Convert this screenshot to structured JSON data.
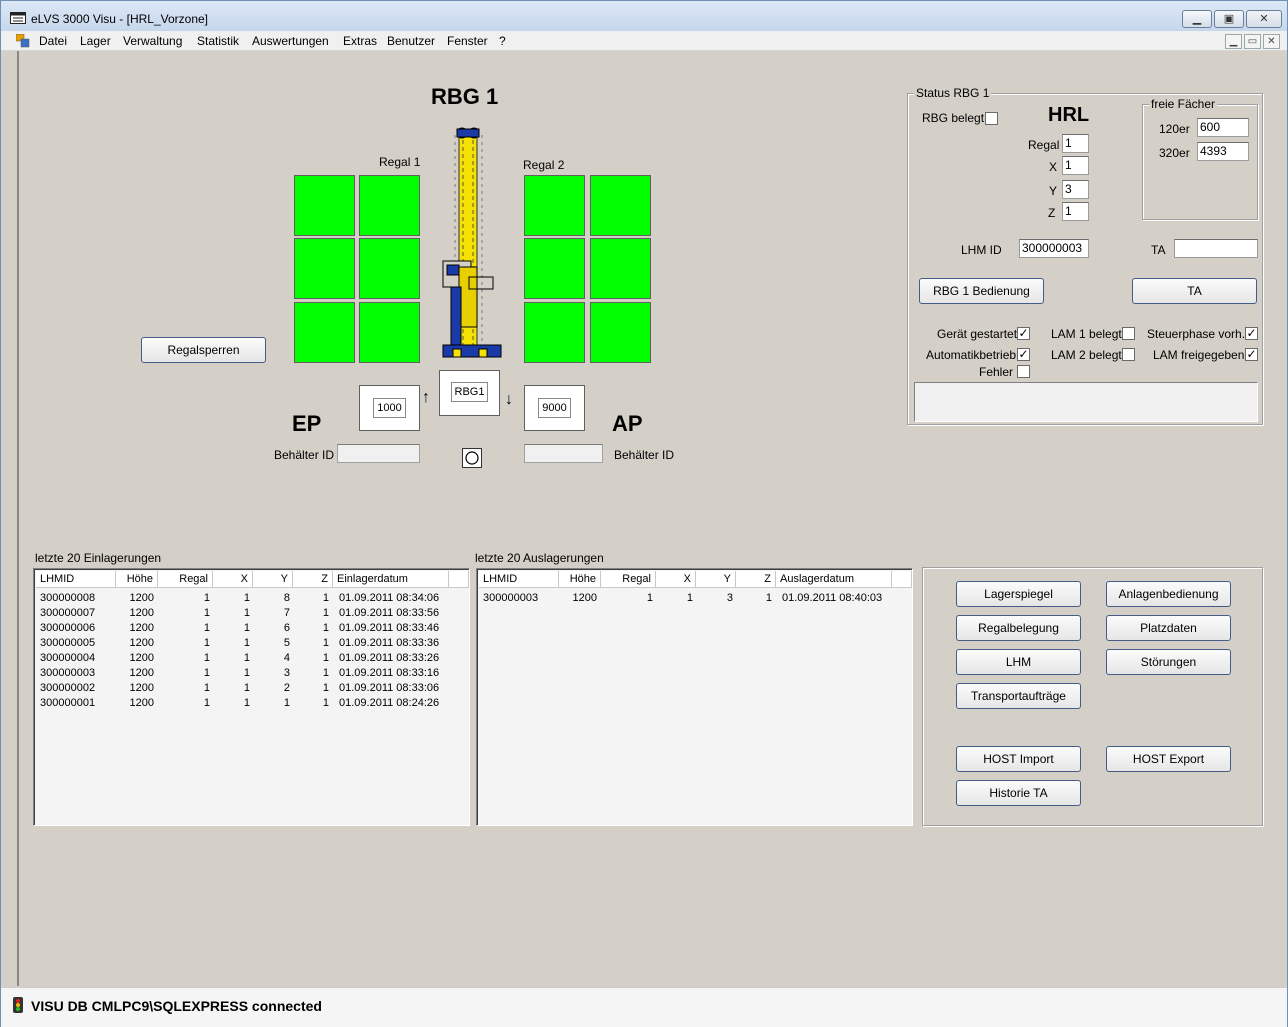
{
  "window": {
    "title": "eLVS 3000 Visu - [HRL_Vorzone]"
  },
  "menu": [
    "Datei",
    "Lager",
    "Verwaltung",
    "Statistik",
    "Auswertungen",
    "Extras",
    "Benutzer",
    "Fenster",
    "?"
  ],
  "visu": {
    "rbg_title": "RBG 1",
    "regal1_label": "Regal 1",
    "regal2_label": "Regal 2",
    "ep_label": "EP",
    "ap_label": "AP",
    "ep_value": "1000",
    "rbg_box": "RBG1",
    "ap_value": "9000",
    "behaelter_id_label_left": "Behälter ID",
    "behaelter_id_label_right": "Behälter ID",
    "behaelter_id_left_value": "",
    "behaelter_id_right_value": "",
    "regalsperren_button": "Regalsperren",
    "arrow_up": "↑",
    "arrow_down": "↓",
    "cell_color": "#00ff00"
  },
  "status": {
    "group_title": "Status RBG 1",
    "rbg_belegt_label": "RBG belegt",
    "rbg_belegt_checked": false,
    "hrl_title": "HRL",
    "regal_label": "Regal",
    "regal_value": "1",
    "x_label": "X",
    "x_value": "1",
    "y_label": "Y",
    "y_value": "3",
    "z_label": "Z",
    "z_value": "1",
    "freie_faecher_title": "freie Fächer",
    "f120_label": "120er",
    "f120_value": "600",
    "f320_label": "320er",
    "f320_value": "4393",
    "lhm_id_label": "LHM ID",
    "lhm_id_value": "300000003",
    "ta_label": "TA",
    "ta_value": "",
    "rbg_bedienung_button": "RBG 1 Bedienung",
    "ta_button": "TA",
    "geraet_gestartet_label": "Gerät gestartet",
    "geraet_gestartet": true,
    "automatikbetrieb_label": "Automatikbetrieb",
    "automatikbetrieb": true,
    "fehler_label": "Fehler",
    "fehler": false,
    "lam1_label": "LAM 1 belegt",
    "lam1": false,
    "lam2_label": "LAM 2 belegt",
    "lam2": false,
    "steuerphase_label": "Steuerphase vorh.",
    "steuerphase": true,
    "lam_freigegeben_label": "LAM freigegeben",
    "lam_freigegeben": true,
    "check_mark": "✓"
  },
  "einlagerungen": {
    "title": "letzte 20 Einlagerungen",
    "columns": [
      "LHMID",
      "Höhe",
      "Regal",
      "X",
      "Y",
      "Z",
      "Einlagerdatum"
    ],
    "rows": [
      [
        "300000008",
        "1200",
        "1",
        "1",
        "8",
        "1",
        "01.09.2011 08:34:06"
      ],
      [
        "300000007",
        "1200",
        "1",
        "1",
        "7",
        "1",
        "01.09.2011 08:33:56"
      ],
      [
        "300000006",
        "1200",
        "1",
        "1",
        "6",
        "1",
        "01.09.2011 08:33:46"
      ],
      [
        "300000005",
        "1200",
        "1",
        "1",
        "5",
        "1",
        "01.09.2011 08:33:36"
      ],
      [
        "300000004",
        "1200",
        "1",
        "1",
        "4",
        "1",
        "01.09.2011 08:33:26"
      ],
      [
        "300000003",
        "1200",
        "1",
        "1",
        "3",
        "1",
        "01.09.2011 08:33:16"
      ],
      [
        "300000002",
        "1200",
        "1",
        "1",
        "2",
        "1",
        "01.09.2011 08:33:06"
      ],
      [
        "300000001",
        "1200",
        "1",
        "1",
        "1",
        "1",
        "01.09.2011 08:24:26"
      ]
    ]
  },
  "auslagerungen": {
    "title": "letzte 20 Auslagerungen",
    "columns": [
      "LHMID",
      "Höhe",
      "Regal",
      "X",
      "Y",
      "Z",
      "Auslagerdatum"
    ],
    "rows": [
      [
        "300000003",
        "1200",
        "1",
        "1",
        "3",
        "1",
        "01.09.2011 08:40:03"
      ]
    ]
  },
  "buttons": {
    "lagerspiegel": "Lagerspiegel",
    "anlagenbedienung": "Anlagenbedienung",
    "regalbelegung": "Regalbelegung",
    "platzdaten": "Platzdaten",
    "lhm": "LHM",
    "stoerungen": "Störungen",
    "transportauftraege": "Transportaufträge",
    "host_import": "HOST Import",
    "host_export": "HOST Export",
    "historie_ta": "Historie TA"
  },
  "statusbar": {
    "text": "VISU DB CMLPC9\\SQLEXPRESS connected"
  }
}
